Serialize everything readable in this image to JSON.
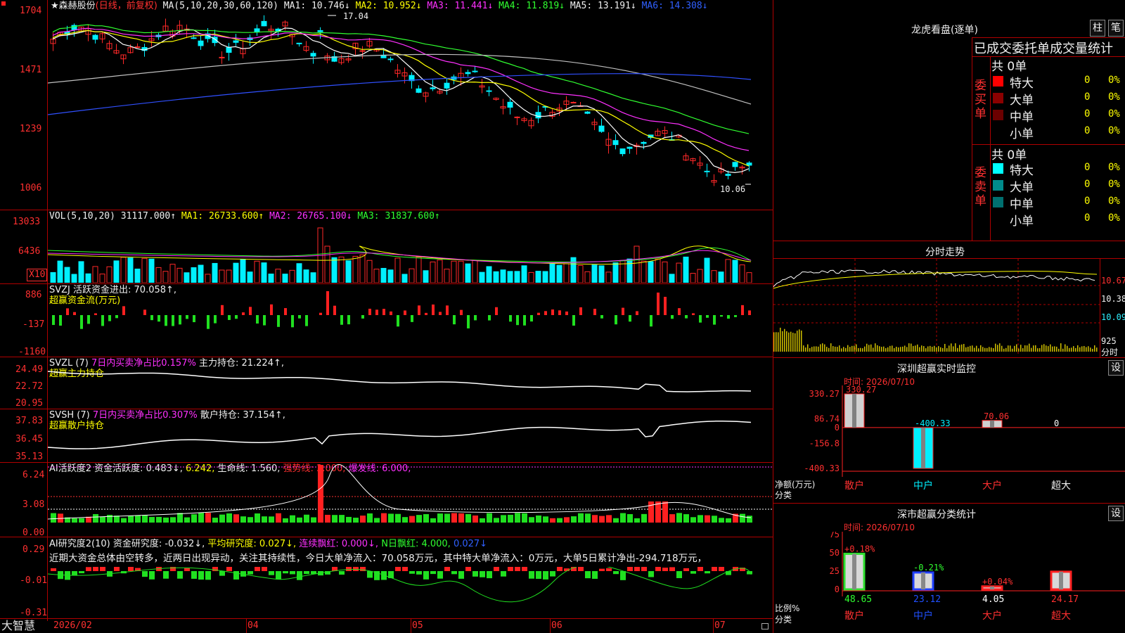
{
  "app": {
    "brand": "大智慧"
  },
  "main": {
    "header": {
      "stock": "★森赫股份",
      "period": "(日线，前复权)",
      "ma_group": "MA(5,10,20,30,60,120)",
      "ma1": "MA1: 10.746↓",
      "ma2": "MA2: 10.952↓",
      "ma3": "MA3: 11.441↓",
      "ma4": "MA4: 11.819↓",
      "ma5": "MA5: 13.191↓",
      "ma6": "MA6: 14.308↓"
    },
    "y_labels": [
      "1704",
      "1471",
      "1239",
      "1006"
    ],
    "high_mark": "17.04",
    "low_mark": "10.06"
  },
  "vol": {
    "header": "VOL(5,10,20)",
    "value": "31117.000↑",
    "ma1": "MA1: 26733.600↑",
    "ma2": "MA2: 26765.100↓",
    "ma3": "MA3: 31837.600↑",
    "y_labels": [
      "13033",
      "6436"
    ],
    "unit": "X10"
  },
  "svzj": {
    "header": "SVZJ  活跃资金进出: 70.058↑,",
    "sub": "超赢资金流(万元)",
    "y_labels": [
      "886",
      "-137",
      "-1160"
    ]
  },
  "svzl": {
    "header_a": "SVZL (7)",
    "header_b": "7日内买卖净占比0.157%",
    "header_c": "主力持仓: 21.224↑,",
    "sub": "超赢主力持仓",
    "y_labels": [
      "24.49",
      "22.72",
      "20.95"
    ]
  },
  "svsh": {
    "header_a": "SVSH (7)",
    "header_b": "7日内买卖净占比0.307%",
    "header_c": "散户持仓: 37.154↑,",
    "sub": "超赢散户持仓",
    "y_labels": [
      "37.83",
      "36.45",
      "35.13"
    ]
  },
  "ai2": {
    "header_a": "AI活跃度2 资金活跃度: 0.483↓,",
    "header_b": "6.242,",
    "header_c": "生命线: 1.560,",
    "header_d": "强势线: 3.000,",
    "header_e": "爆发线: 6.000,",
    "y_labels": [
      "6.24",
      "3.08",
      "0.00"
    ]
  },
  "ai_research": {
    "header_a": "AI研究度2(10) 资金研究度: -0.032↓,",
    "header_b": "平均研究度: 0.027↓,",
    "header_c": "连续飘红: 0.000↓,",
    "header_d": "N日飘红: 4.000,",
    "header_e": "0.027↓",
    "commentary": "近期大资金总体由空转多，近两日出现异动，关注其持续性，今日大单净流入：70.058万元，其中特大单净流入：0万元，大单5日累计净出-294.718万元，",
    "y_labels": [
      "0.29",
      "-0.01",
      "-0.31"
    ]
  },
  "date_axis": {
    "labels": [
      "2026/02",
      "04",
      "05",
      "06",
      "07"
    ]
  },
  "right": {
    "longhu": {
      "title": "龙虎看盘(逐单)",
      "btn1": "柱",
      "btn2": "笔",
      "subtitle": "已成交委托单成交量统计",
      "buy_label": "委买单",
      "sell_label": "委卖单",
      "buy_total": "共 0单",
      "sell_total": "共 0单",
      "rows": [
        {
          "name": "特大",
          "count": "0",
          "pct": "0%"
        },
        {
          "name": "大单",
          "count": "0",
          "pct": "0%"
        },
        {
          "name": "中单",
          "count": "0",
          "pct": "0%"
        },
        {
          "name": "小单",
          "count": "0",
          "pct": "0%"
        }
      ],
      "colors": {
        "buy": [
          "#ff0000",
          "#8b0000",
          "#6b0000",
          "#000000"
        ],
        "sell": [
          "#00ffff",
          "#008b8b",
          "#007070",
          "#000000"
        ]
      }
    },
    "intraday": {
      "title": "分时走势",
      "y_labels": [
        "10.67",
        "10.38",
        "10.09",
        "925"
      ],
      "unit": "分时"
    },
    "monitor": {
      "title": "深圳超赢实时监控",
      "btn": "设",
      "time": "时间: 2026/07/10",
      "y_labels": [
        "330.27",
        "86.74",
        "0",
        "-156.8",
        "-400.33"
      ],
      "net_label": "净额(万元)",
      "cat_label": "分类",
      "categories": [
        "散户",
        "中户",
        "大户",
        "超大"
      ]
    },
    "classify": {
      "title": "深市超赢分类统计",
      "btn": "设",
      "time": "时间: 2026/07/10",
      "y_labels": [
        "75",
        "50",
        "25",
        "0"
      ],
      "ratio_label": "比例%",
      "cat_label": "分类",
      "categories": [
        "散户",
        "中户",
        "大户",
        "超大"
      ]
    }
  },
  "chart_data": [
    {
      "type": "bar",
      "title": "深圳超赢实时监控",
      "ylabel": "净额(万元)",
      "categories": [
        "散户",
        "中户",
        "大户",
        "超大"
      ],
      "values": [
        330.27,
        -400.33,
        70.06,
        0
      ],
      "value_labels": [
        "330.27",
        "-400.33",
        "70.06",
        "0"
      ],
      "ylim": [
        -400.33,
        330.27
      ]
    },
    {
      "type": "bar",
      "title": "深市超赢分类统计",
      "ylabel": "比例%",
      "categories": [
        "散户",
        "中户",
        "大户",
        "超大"
      ],
      "values": [
        48.65,
        23.12,
        4.05,
        24.17
      ],
      "value_labels": [
        "48.65",
        "23.12",
        "4.05",
        "24.17"
      ],
      "change_labels": [
        "+0.18%",
        "-0.21%",
        "+0.04%",
        ""
      ],
      "ylim": [
        0,
        75
      ]
    }
  ]
}
